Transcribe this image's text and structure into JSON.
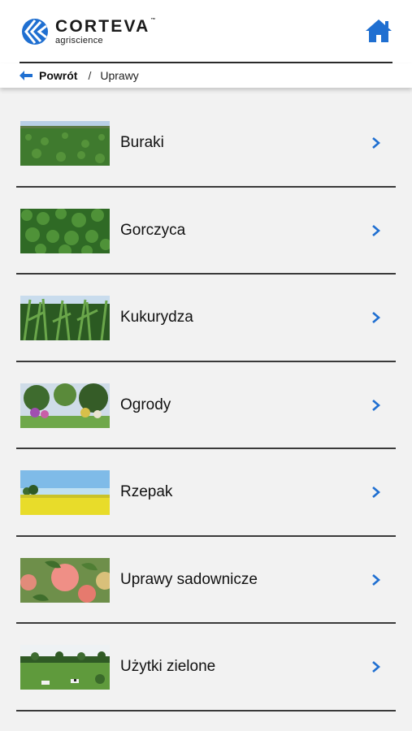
{
  "header": {
    "logo_word": "CORTEVA",
    "logo_tm": "™",
    "logo_sub": "agriscience",
    "home_icon": "home-icon"
  },
  "breadcrumb": {
    "back_label": "Powrót",
    "separator": "/",
    "current": "Uprawy"
  },
  "colors": {
    "accent": "#1f6fd1",
    "divider": "#3a3a3a",
    "background": "#f2f2f2"
  },
  "crops": [
    {
      "label": "Buraki",
      "image": "sugar-beet-field"
    },
    {
      "label": "Gorczyca",
      "image": "mustard-leaves"
    },
    {
      "label": "Kukurydza",
      "image": "corn-field"
    },
    {
      "label": "Ogrody",
      "image": "garden"
    },
    {
      "label": "Rzepak",
      "image": "rapeseed-field"
    },
    {
      "label": "Uprawy sadownicze",
      "image": "apples"
    },
    {
      "label": "Użytki zielone",
      "image": "pasture-with-cows"
    }
  ]
}
